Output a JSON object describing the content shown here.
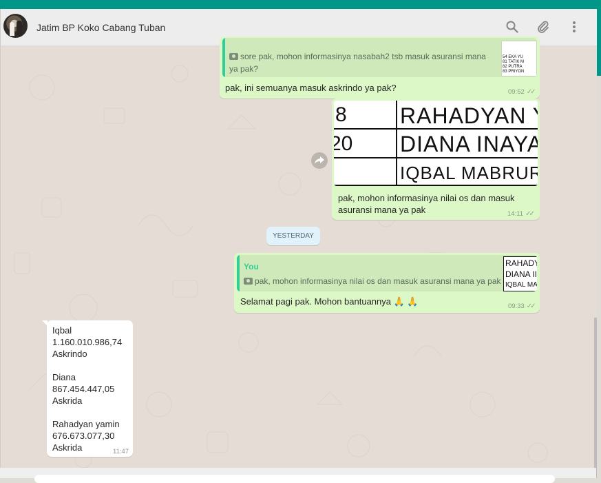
{
  "chat": {
    "title": "Jatim BP Koko Cabang Tuban"
  },
  "icons": {
    "search": "search-icon",
    "attach": "paperclip-icon",
    "menu": "menu-icon"
  },
  "colors": {
    "accent": "#009688",
    "outgoing_bubble": "#dcf8c6",
    "incoming_bubble": "#ffffff",
    "chat_background": "#e5ddd5",
    "quote_bar": "#35cd96"
  },
  "messages": {
    "m1": {
      "quote_text": "sore pak, mohon informasinya nasabah2 tsb masuk asuransi mana ya pak?",
      "quote_thumb_rows": [
        "54  EKA YU",
        "81  TATIK M",
        "82  PUTRA",
        "83  PRIYON"
      ],
      "text": "pak, ini semuanya masuk askrindo ya pak?",
      "time": "09:52"
    },
    "m2": {
      "image_rows": [
        {
          "num": "8",
          "name": "RAHADYAN Y"
        },
        {
          "num": "20",
          "name": "DIANA INAYAT"
        },
        {
          "num": "",
          "name": "IQBAL MABRURI"
        }
      ],
      "text": "pak, mohon informasinya nilai os dan masuk asuransi mana ya pak",
      "time": "14:11"
    },
    "date_divider": "YESTERDAY",
    "m3": {
      "quote_author": "You",
      "quote_text": "pak, mohon informasinya nilai os dan masuk asuransi mana ya pak",
      "quote_thumb_rows": [
        "RAHADY",
        "DIANA II",
        "IQBAL MA"
      ],
      "text": "Selamat pagi pak.  Mohon bantuannya 🙏 🙏",
      "time": "09:33"
    },
    "m4": {
      "lines": [
        "Iqbal",
        "1.160.010.986,74",
        "Askrindo",
        "",
        "Diana",
        "867.454.447,05",
        "Askrida",
        "",
        "Rahadyan yamin",
        "676.673.077,30",
        "Askrida"
      ],
      "time": "11:47"
    }
  }
}
